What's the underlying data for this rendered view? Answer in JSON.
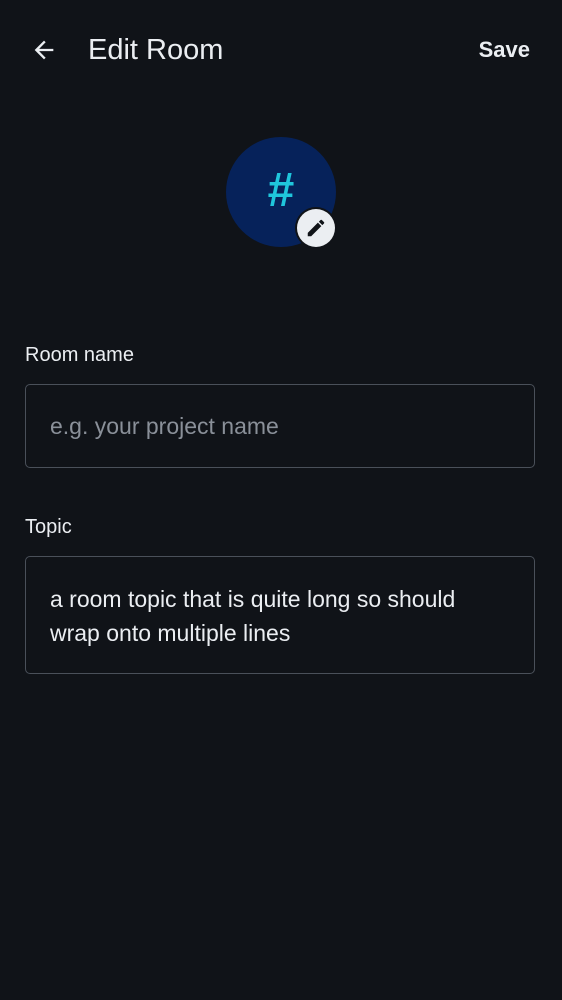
{
  "header": {
    "back_icon": "arrow-left-icon",
    "title": "Edit Room",
    "save_label": "Save"
  },
  "avatar": {
    "glyph": "#",
    "background_color": "#06225a",
    "glyph_color": "#1fc6dc",
    "edit_icon": "pencil-icon"
  },
  "form": {
    "room_name": {
      "label": "Room name",
      "value": "",
      "placeholder": "e.g. your project name"
    },
    "topic": {
      "label": "Topic",
      "value": "a room topic that is quite long so should wrap onto multiple lines"
    }
  },
  "colors": {
    "background": "#101318",
    "text": "#ebeef2",
    "border": "#4a5059",
    "placeholder": "#8a9099"
  }
}
